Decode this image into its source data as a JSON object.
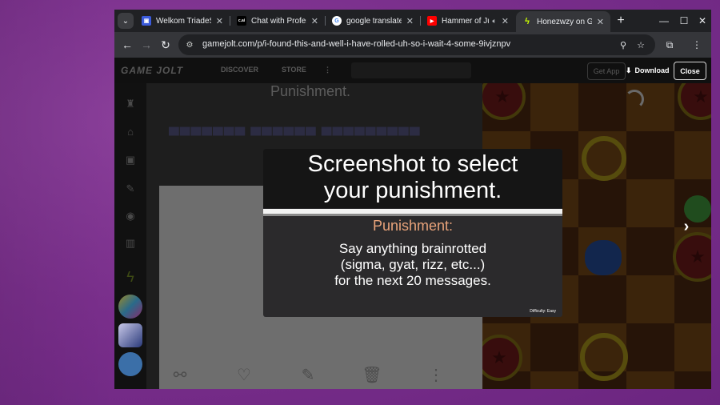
{
  "browser": {
    "tabs": [
      {
        "title": "Welkom TriadeStap",
        "favicon": "triadestap-icon",
        "active": false
      },
      {
        "title": "Chat with Professo",
        "favicon": "c.ai",
        "active": false
      },
      {
        "title": "google translate - G",
        "favicon": "google-icon",
        "active": false
      },
      {
        "title": "Hammer of Justice",
        "favicon": "youtube-icon",
        "active": false,
        "audio": true
      },
      {
        "title": "Honezwzy on Gam",
        "favicon": "gamejolt-icon",
        "active": true
      }
    ],
    "url": "gamejolt.com/p/i-found-this-and-well-i-have-rolled-uh-so-i-wait-4-some-9ivjznpv"
  },
  "gamejolt": {
    "logo": "GAME JOLT",
    "nav": [
      "DISCOVER",
      "STORE"
    ],
    "get_app": "Get App",
    "download": "Download",
    "close": "Close",
    "post_heading": "Punishment."
  },
  "overlay": {
    "title_line1": "Screenshot to select",
    "title_line2": "your punishment.",
    "label": "Punishment:",
    "body_line1": "Say anything brainrotted",
    "body_line2": "(sigma, gyat, rizz, etc...)",
    "body_line3": "for the next 20 messages.",
    "difficulty": "Difficulty: Easy"
  },
  "colors": {
    "desktop": "#7a2f8c",
    "overlay_label": "#e9a37a",
    "chrome_bg": "#202124"
  }
}
